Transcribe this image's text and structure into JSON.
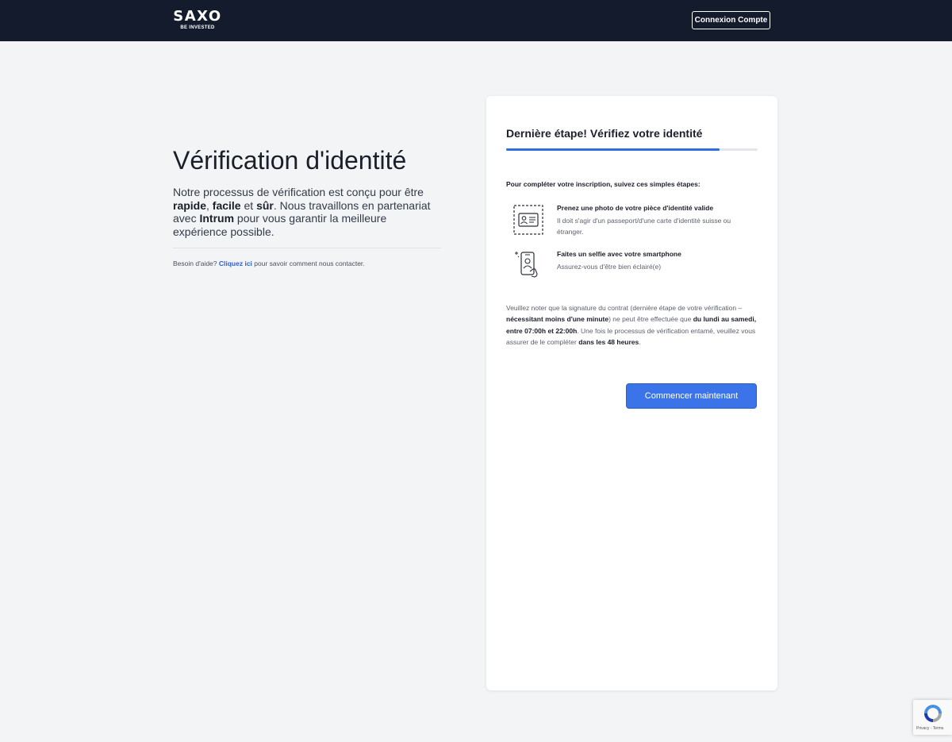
{
  "header": {
    "logo_word": "SAXO",
    "logo_tagline": "BE INVESTED",
    "login_label": "Connexion Compte",
    "bg_color": "#141b2d"
  },
  "main": {
    "title": "Vérification d'identité",
    "intro_part1": "Notre processus de vérification est conçu pour être ",
    "intro_bold1": "rapide",
    "intro_sep1": ", ",
    "intro_bold2": "facile",
    "intro_sep2": " et ",
    "intro_bold3": "sûr",
    "intro_part2": ". Nous travaillons en partenariat avec ",
    "intro_bold4": "Intrum",
    "intro_part3": " pour vous garantir la meilleure expérience possible.",
    "help_prefix": "Besoin d'aide? ",
    "help_link": "Cliquez ici",
    "help_suffix": " pour savoir comment nous contacter."
  },
  "card": {
    "title": "Dernière étape! Vérifiez votre identité",
    "progress_fraction": 0.85,
    "accent_color": "#2f6ee0",
    "steps_intro": "Pour compléter votre inscription, suivez ces simples étapes:",
    "steps": [
      {
        "icon": "id-card-icon",
        "title": "Prenez une photo de votre pièce d'identité valide",
        "description": "Il doit s'agir d'un passeport/d'une carte d'identité suisse ou étranger."
      },
      {
        "icon": "selfie-phone-icon",
        "title": "Faites un selfie avec votre smartphone",
        "description": "Assurez-vous d'être bien éclairé(e)"
      }
    ],
    "note_part1": "Veuillez noter que la signature du contrat (dernière étape de votre vérification – ",
    "note_bold1": "nécessitant moins d'une minute",
    "note_part2": ") ne peut être effectuée que ",
    "note_bold2": "du lundi au samedi, entre 07:00h et 22:00h",
    "note_part3": ". Une fois le processus de vérification entamé, veuillez vous assurer de le compléter ",
    "note_bold3": "dans les 48 heures",
    "note_part4": ".",
    "start_label": "Commencer maintenant",
    "button_color": "#3b74e8"
  },
  "recaptcha": {
    "text": "Privacy - Terms"
  }
}
